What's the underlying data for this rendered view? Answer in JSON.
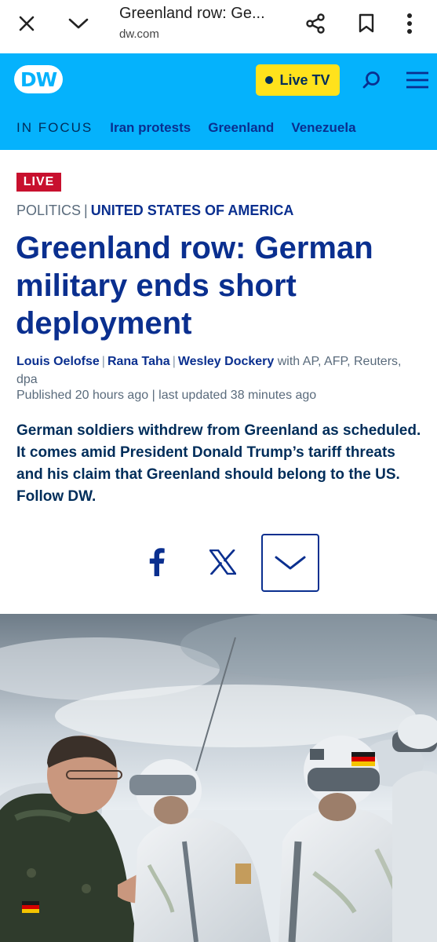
{
  "browser": {
    "page_title": "Greenland row: Ge...",
    "domain": "dw.com"
  },
  "header": {
    "logo_text": "DW",
    "live_tv_label": "Live TV",
    "in_focus_label": "IN FOCUS",
    "focus_links": [
      "Iran protests",
      "Greenland",
      "Venezuela"
    ]
  },
  "article": {
    "badge": "LIVE",
    "category": "POLITICS",
    "section_separator": "|",
    "country": "UNITED STATES OF AMERICA",
    "headline": "Greenland row: German military ends short deployment",
    "authors": [
      "Louis Oelofse",
      "Rana Taha",
      "Wesley Dockery"
    ],
    "agencies": "with AP, AFP, Reuters, dpa",
    "published": "Published 20 hours ago | last updated 38 minutes ago",
    "teaser": "German soldiers withdrew from Greenland as scheduled. It comes amid President Donald Trump’s tariff threats and his claim that Greenland should belong to the US. Follow DW.",
    "share": {
      "facebook_icon": "facebook-icon",
      "x_icon": "x-icon",
      "more_icon": "chevron-down-icon"
    }
  },
  "colors": {
    "header_bg": "#05b2fc",
    "live_tv_bg": "#ffe21c",
    "live_badge": "#c8102e",
    "link_blue": "#0a2f8f",
    "text_navy": "#002d5a"
  }
}
